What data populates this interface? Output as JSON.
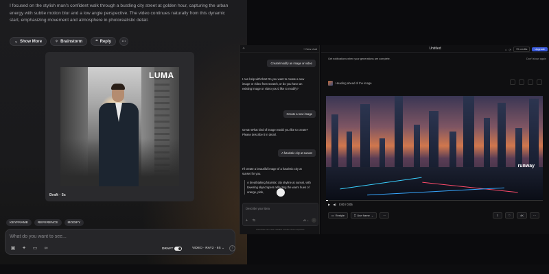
{
  "luma": {
    "prompt_text": "I focused on the stylish man's confident walk through a bustling city street at golden hour, capturing the urban energy with subtle motion blur and a low angle perspective. The video continues naturally from this dynamic start, emphasizing movement and atmosphere in photorealistic detail.",
    "actions": {
      "show_more": "Show More",
      "brainstorm": "Brainstorm",
      "reply": "Reply",
      "more": "···"
    },
    "card": {
      "logo": "LUMA",
      "draft_label": "Draft · 5s"
    },
    "tags": [
      "KEYFRAME",
      "REFERENCE",
      "MODIFY"
    ],
    "composer": {
      "placeholder": "What do you want to see...",
      "draft_label": "DRAFT",
      "model_label": "VIDEO · RAY2 · 5S ⌄"
    }
  },
  "chat": {
    "new_chat": "+ New chat",
    "messages": [
      {
        "role": "user",
        "text": "Create/modify an image or video"
      },
      {
        "role": "ai",
        "text": "I can help with that! Do you want to create a new image or video from scratch, or do you have an existing image or video you'd like to modify?"
      },
      {
        "role": "user",
        "text": "Create a new image"
      },
      {
        "role": "ai",
        "text": "Great! What kind of image would you like to create? Please describe it in detail."
      },
      {
        "role": "user",
        "text": "A futuristic city at sunset"
      },
      {
        "role": "ai",
        "text": "I'll create a beautiful image of a futuristic city at sunset for you."
      }
    ],
    "quote": "A breathtaking futuristic city skyline at sunset, with towering skyscrapers reflecting the warm hues of orange, pink,",
    "input_placeholder": "Describe your idea",
    "footer": "Chat Mode can make mistakes. Double check responses."
  },
  "runway": {
    "title": "Untitled",
    "credits": "70 credits",
    "upgrade": "Upgrade",
    "notification": "Get notifications when your generations are complete.",
    "dont_show": "Don't show again",
    "heading": "Heading ahead of the image",
    "logo": "runway",
    "time": "0:00 / 0:05",
    "progress_fraction": 0.01,
    "buttons": {
      "restyle": "Restyle",
      "use_frame": "Use frame",
      "more": "···",
      "quality": "4K"
    }
  }
}
